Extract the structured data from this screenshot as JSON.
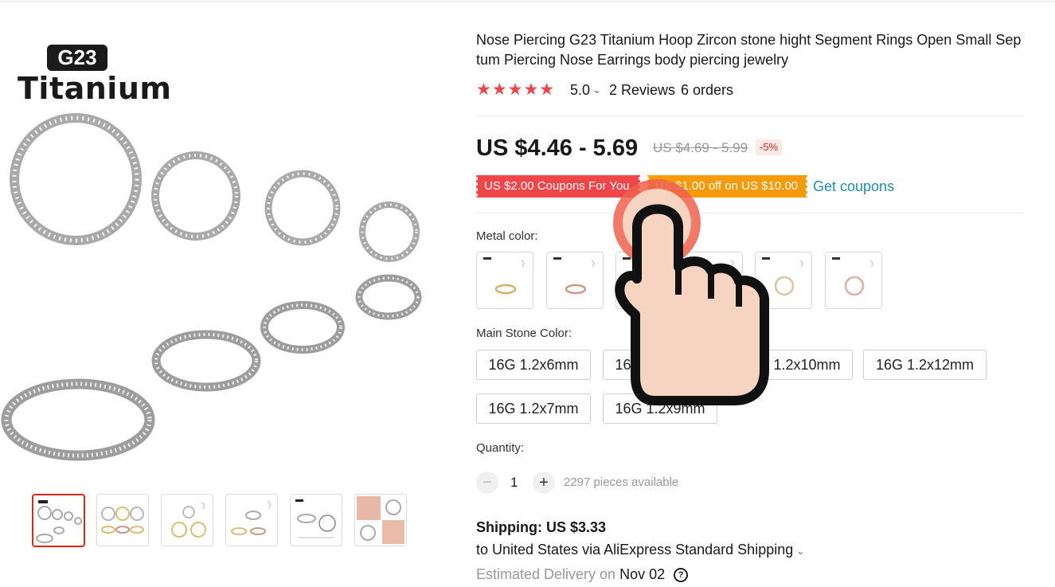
{
  "brand_badge": "G23",
  "brand_word": "Titanium",
  "product": {
    "title": "Nose Piercing G23 Titanium Hoop Zircon stone hight Segment Rings Open Small Sep tum Piercing Nose Earrings body piercing jewelry",
    "stars": "★★★★★",
    "rating": "5.0",
    "reviews": "2 Reviews",
    "orders": "6 orders",
    "price": "US $4.46 - 5.69",
    "price_original": "US $4.69 - 5.99",
    "discount": "-5%"
  },
  "coupons": {
    "coupon_1": "US $2.00 Coupons For You",
    "coupon_2": "US $1.00 off on US $10.00",
    "get_coupons": "Get coupons"
  },
  "metal_color": {
    "label": "Metal color:",
    "swatches": [
      "gold",
      "rose gold",
      "silver",
      "silver",
      "gold",
      "rose gold"
    ]
  },
  "main_stone_color": {
    "label": "Main Stone Color:",
    "options": [
      "16G 1.2x6mm",
      "16G 1.2x8mm",
      "16G 1.2x10mm",
      "16G 1.2x12mm",
      "16G 1.2x7mm",
      "16G 1.2x9mm"
    ]
  },
  "quantity": {
    "label": "Quantity:",
    "minus": "−",
    "value": "1",
    "plus": "+",
    "available": "2297 pieces available"
  },
  "shipping": {
    "title": "Shipping: US $3.33",
    "line": "to United States via AliExpress Standard Shipping",
    "delivery_label": "Estimated Delivery on",
    "delivery_date": "Nov 02",
    "help": "?"
  },
  "icons": {
    "rating_chevron": "chevron-down-icon",
    "shipping_chevron": "chevron-down-icon",
    "help": "help-icon",
    "pointer": "hand-pointer-icon"
  },
  "colors": {
    "star": "#f0464a",
    "price_red": "#e2231a",
    "coupon_red": "#f0464a",
    "coupon_orange": "#f79a0a",
    "link": "#1a8fb0",
    "hand_fill": "#f7d3c2",
    "tap_ring": "#f0604e"
  }
}
